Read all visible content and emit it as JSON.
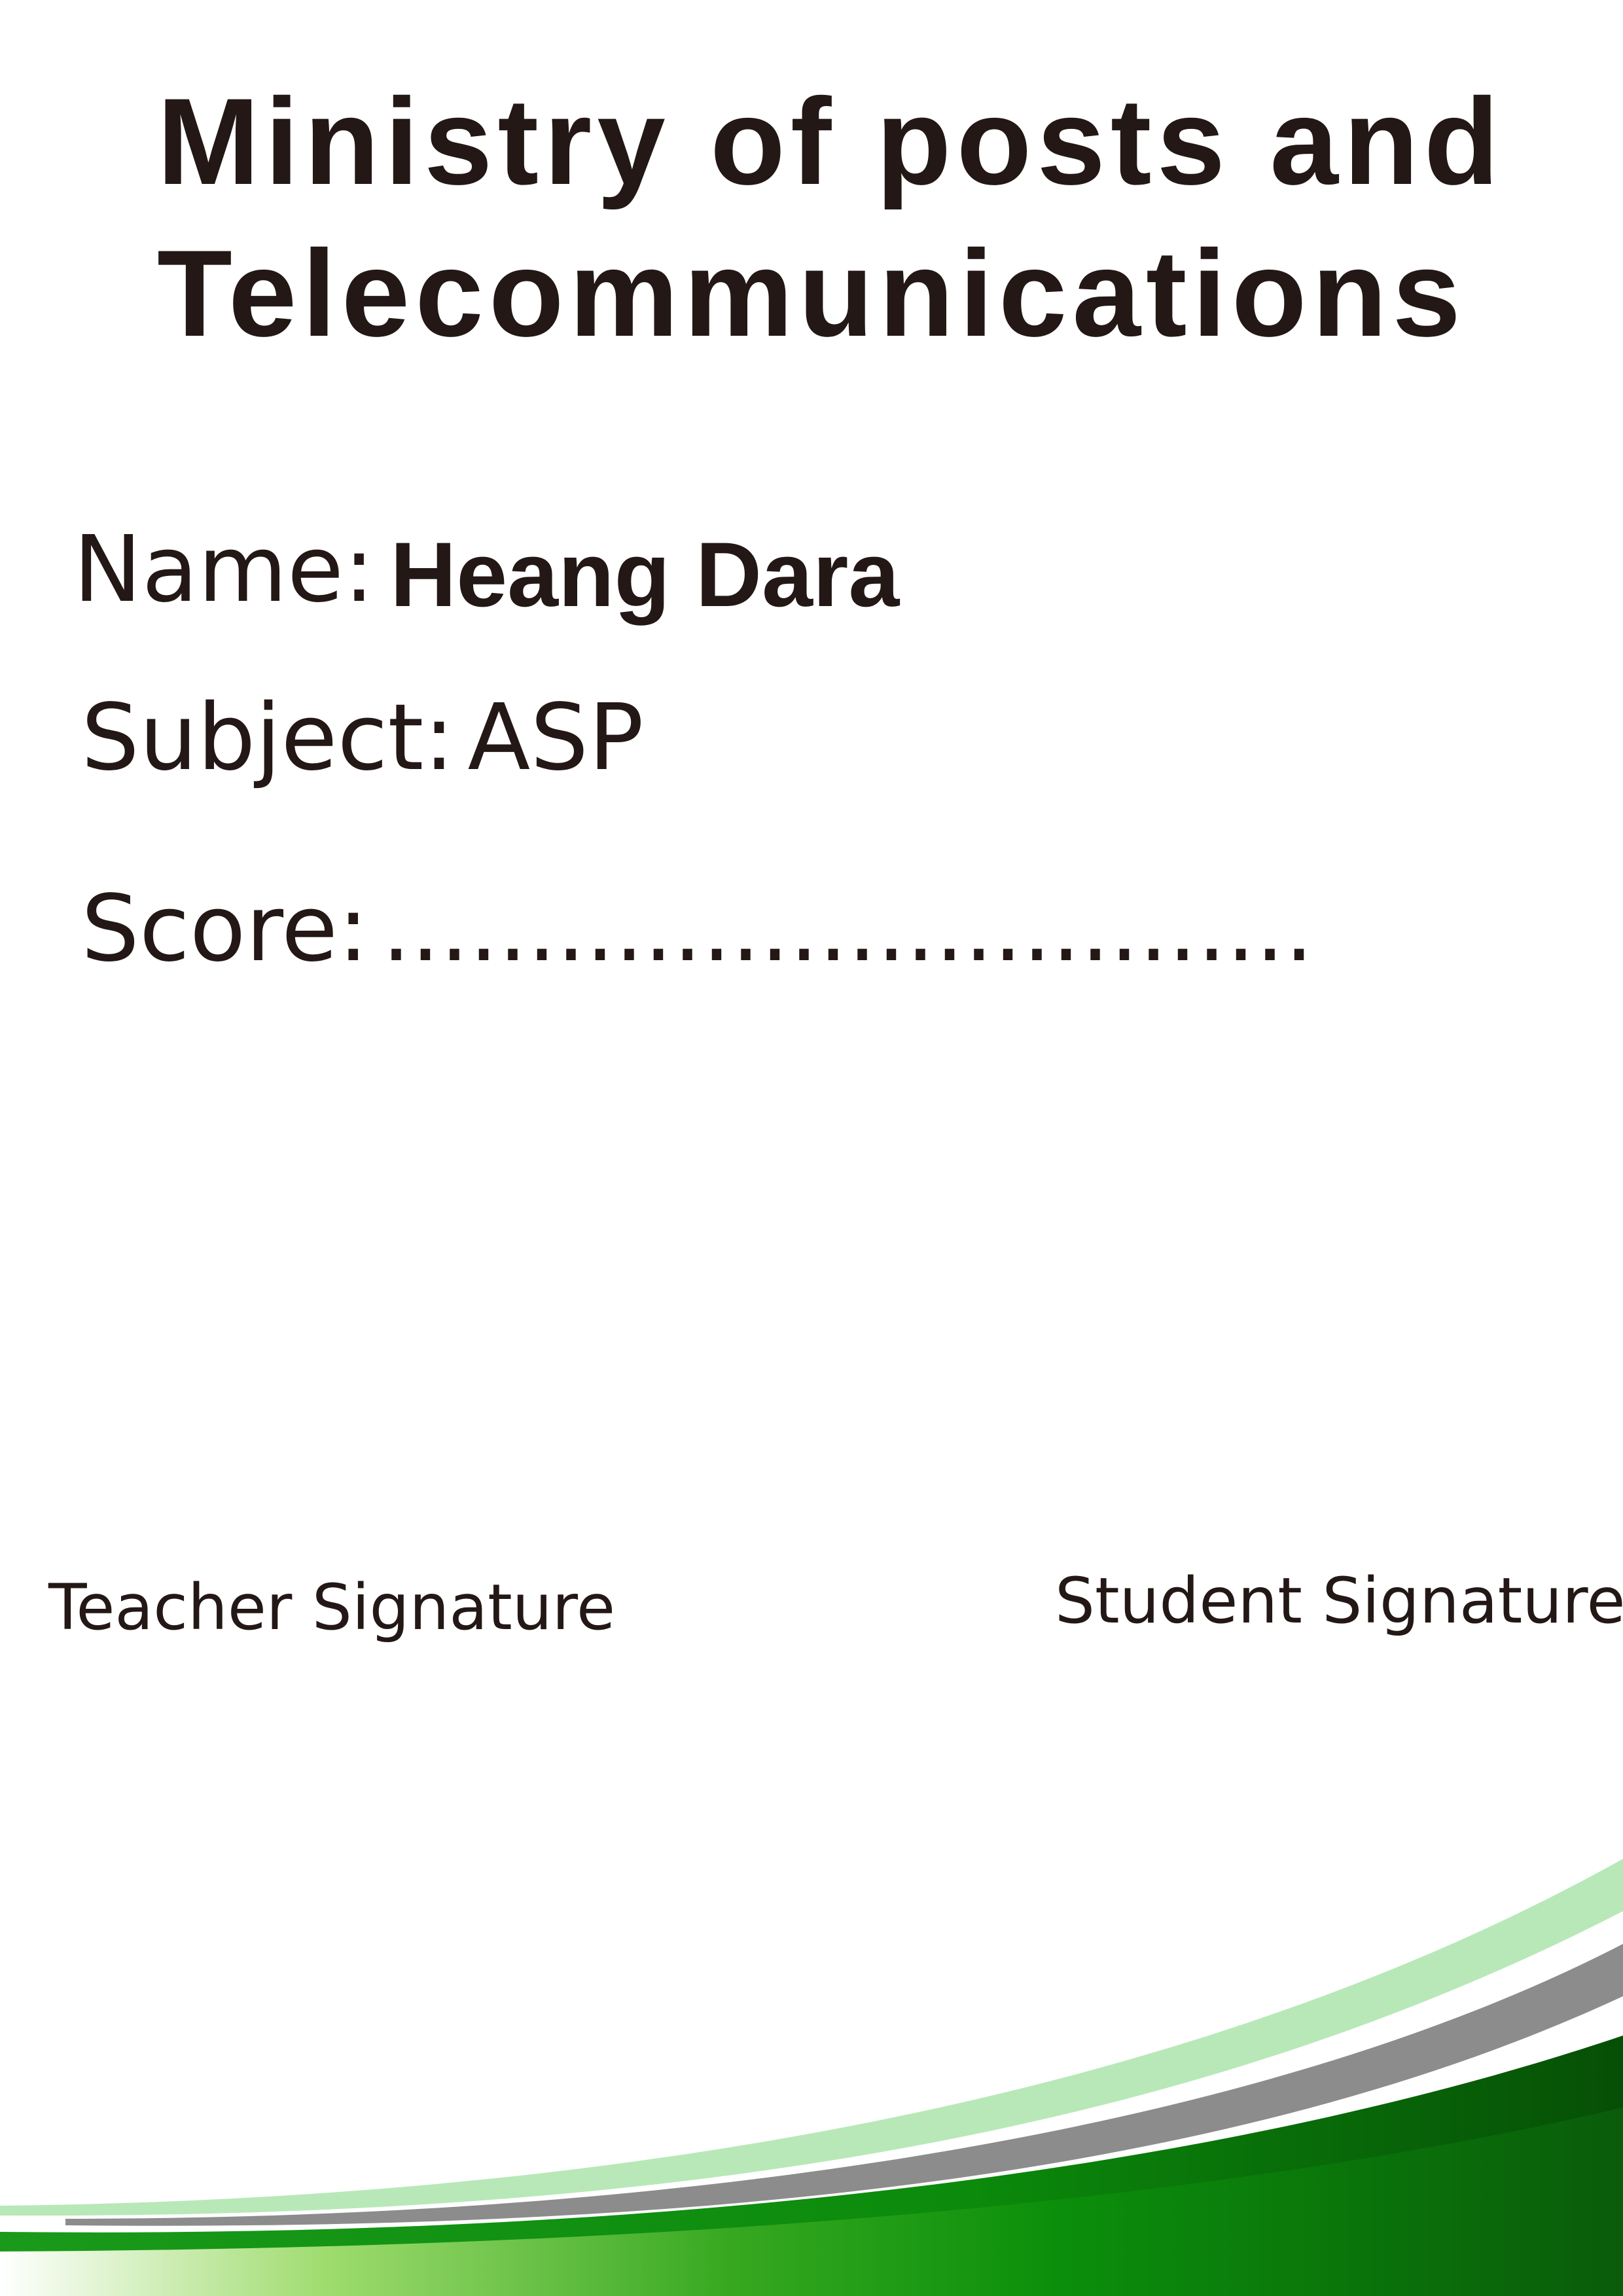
{
  "header": {
    "title_line_1": "Ministry of posts and",
    "title_line_2": "Telecommunications"
  },
  "fields": {
    "name_label": "Name:",
    "name_value": "Heang Dara",
    "subject_label": "Subject:",
    "subject_value": "ASP",
    "score_label": "Score:",
    "score_value": "................................"
  },
  "signatures": {
    "teacher": "Teacher Signature",
    "student": "Student Signature"
  },
  "colors": {
    "text": "#231815",
    "light_green": "#b8e8b8",
    "gray": "#8c8c8c",
    "dark_green": "#0a5c0a",
    "bright_green": "#0b8f0b"
  }
}
